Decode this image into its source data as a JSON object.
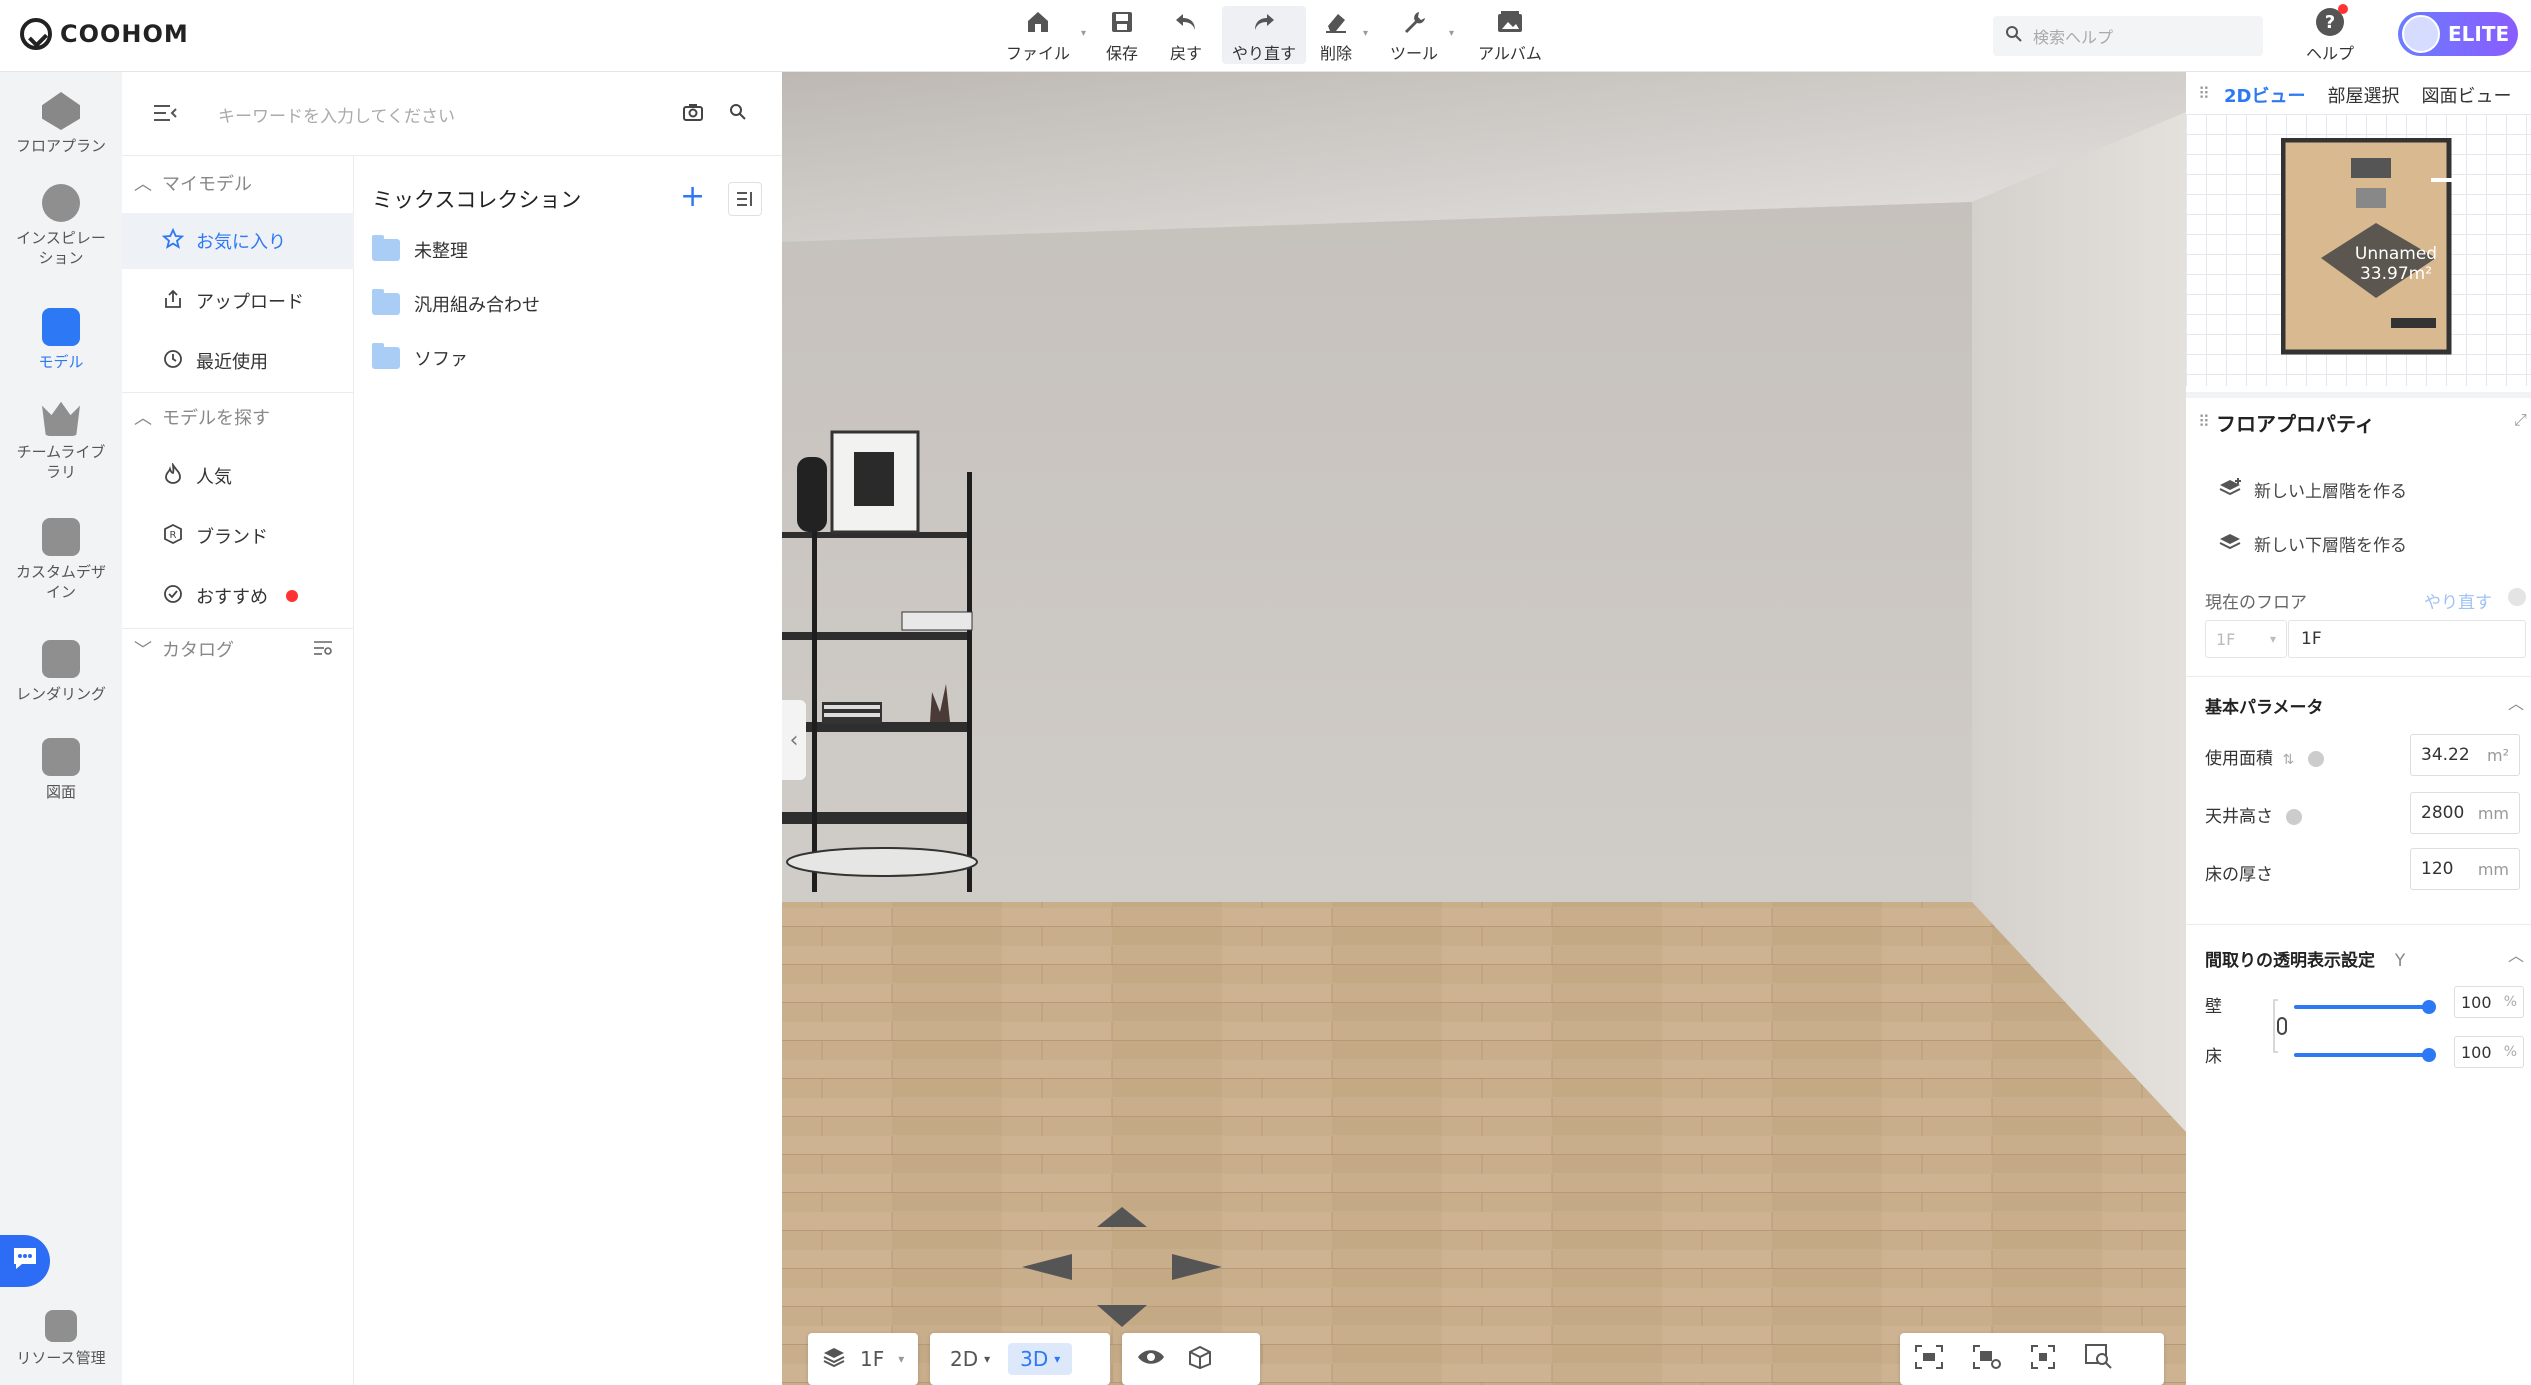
{
  "brand": "COOHOM",
  "toolbar": {
    "file": "ファイル",
    "save": "保存",
    "undo": "戻す",
    "redo": "やり直す",
    "delete": "削除",
    "tools": "ツール",
    "album": "アルバム"
  },
  "search_help": {
    "placeholder": "検索ヘルプ"
  },
  "help_label": "ヘルプ",
  "account_badge": "ELITE",
  "leftnav": [
    {
      "label": "フロアプラン",
      "icon": "floorplan-icon"
    },
    {
      "label": "インスピレー ション",
      "icon": "lightbulb-icon"
    },
    {
      "label": "モデル",
      "icon": "sofa-icon",
      "active": true
    },
    {
      "label": "チームライブ ラリ",
      "icon": "crown-icon"
    },
    {
      "label": "カスタムデザ イン",
      "icon": "custom-design-icon"
    },
    {
      "label": "レンダリング",
      "icon": "camera-icon"
    },
    {
      "label": "図面",
      "icon": "drawing-icon"
    }
  ],
  "resource_mgmt": "リソース管理",
  "model_panel": {
    "search_placeholder": "キーワードを入力してください",
    "my_models": "マイモデル",
    "favorites": "お気に入り",
    "upload": "アップロード",
    "recent": "最近使用",
    "find_models": "モデルを探す",
    "popular": "人気",
    "brand": "ブランド",
    "recommended": "おすすめ",
    "catalog": "カタログ"
  },
  "collection": {
    "title": "ミックスコレクション",
    "folders": [
      "未整理",
      "汎用組み合わせ",
      "ソファ"
    ]
  },
  "viewport_bar": {
    "floor": "1F",
    "mode_2d": "2D",
    "mode_3d": "3D"
  },
  "minimap": {
    "tab_2d": "2Dビュー",
    "tab_room": "部屋選択",
    "tab_drawing": "図面ビュー",
    "room_name": "Unnamed",
    "room_area": "33.97m²"
  },
  "floor_props": {
    "title": "フロアプロパティ",
    "new_upper": "新しい上層階を作る",
    "new_lower": "新しい下層階を作る",
    "current_floor_label": "現在のフロア",
    "redo_link": "やり直す",
    "floor_select": "1F",
    "floor_name": "1F",
    "basic_params": "基本パラメータ",
    "area_label": "使用面積",
    "area_value": "34.22",
    "area_unit": "m²",
    "ceiling_label": "天井高さ",
    "ceiling_value": "2800",
    "ceiling_unit": "mm",
    "floor_thickness_label": "床の厚さ",
    "floor_thickness_value": "120",
    "floor_thickness_unit": "mm",
    "transparency_title": "間取りの透明表示設定",
    "transparency_key": "Y",
    "wall_label": "壁",
    "wall_value": "100",
    "floor_label": "床",
    "floor_value": "100",
    "pct_unit": "%"
  }
}
